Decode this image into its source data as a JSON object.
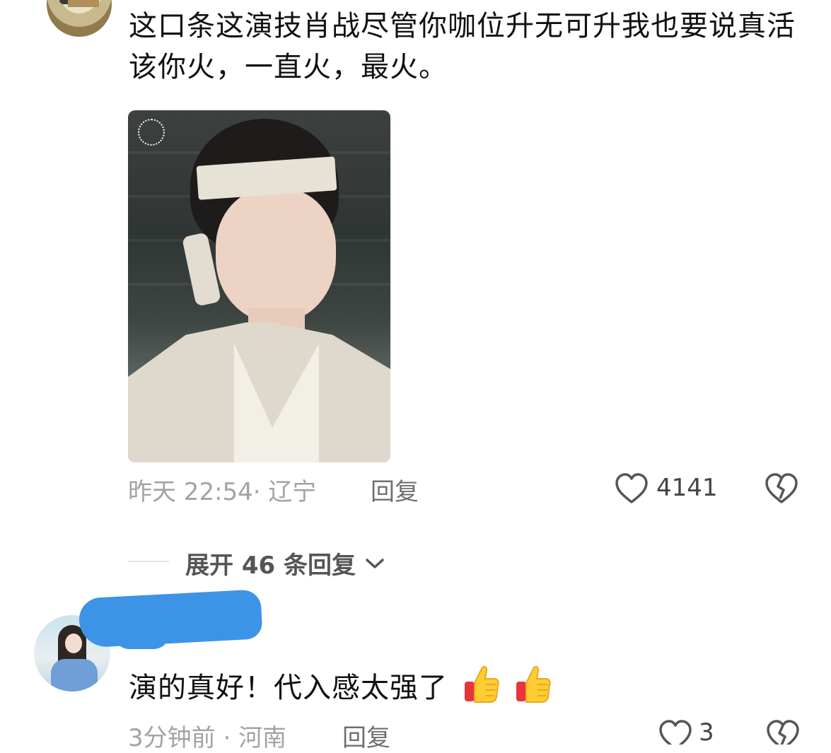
{
  "comments": [
    {
      "text": "这口条这演技肖战尽管你咖位升无可升我也要说真活该你火，一直火，最火。",
      "time": "昨天 22:54·",
      "location": "辽宁",
      "reply_label": "回复",
      "likes": "4141",
      "expand_label": "展开 46 条回复"
    },
    {
      "text": "演的真好！代入感太强了",
      "emoji": [
        "thumbs-up",
        "thumbs-up"
      ],
      "time": "3分钟前 ·",
      "location": "河南",
      "reply_label": "回复",
      "likes": "3"
    }
  ]
}
